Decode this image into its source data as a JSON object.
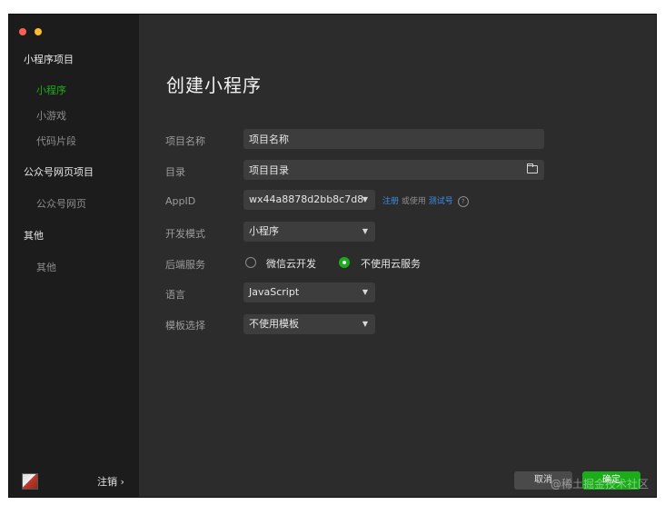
{
  "sidebar": {
    "groups": [
      {
        "label": "小程序项目",
        "items": [
          "小程序",
          "小游戏",
          "代码片段"
        ]
      },
      {
        "label": "公众号网页项目",
        "items": [
          "公众号网页"
        ]
      },
      {
        "label": "其他",
        "items": [
          "其他"
        ]
      }
    ],
    "active_item": "小程序",
    "logout_label": "注销 ›"
  },
  "main": {
    "title": "创建小程序",
    "form": {
      "project_name": {
        "label": "项目名称",
        "value": "项目名称"
      },
      "directory": {
        "label": "目录",
        "value": "项目目录"
      },
      "appid": {
        "label": "AppID",
        "value": "wx44a8878d2bb8c7d8",
        "register": "注册",
        "or_use": "或使用",
        "test_account": "测试号",
        "help": "?"
      },
      "dev_mode": {
        "label": "开发模式",
        "value": "小程序"
      },
      "backend": {
        "label": "后端服务",
        "option_cloud": "微信云开发",
        "option_none": "不使用云服务",
        "selected": "不使用云服务"
      },
      "language": {
        "label": "语言",
        "value": "JavaScript"
      },
      "template": {
        "label": "模板选择",
        "value": "不使用模板"
      }
    }
  },
  "footer": {
    "cancel_label": "取消",
    "ok_label": "确定"
  },
  "watermark": "@稀土掘金技术社区",
  "colors": {
    "accent": "#1aad19",
    "link": "#3b8ee8",
    "background": "#2c2c2c",
    "sidebar": "#1c1c1c"
  },
  "icons": [
    "folder-icon",
    "chevron-down-icon",
    "help-icon",
    "avatar"
  ]
}
